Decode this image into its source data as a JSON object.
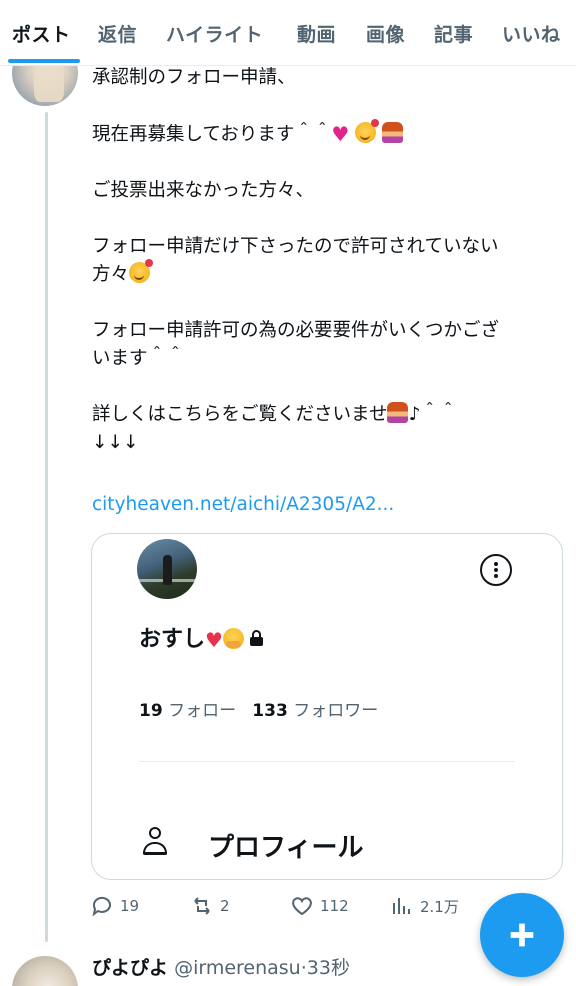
{
  "tabs": [
    {
      "label": "ポスト",
      "active": true
    },
    {
      "label": "返信"
    },
    {
      "label": "ハイライト"
    },
    {
      "label": "動画"
    },
    {
      "label": "画像"
    },
    {
      "label": "記事"
    },
    {
      "label": "いいね"
    }
  ],
  "tweet": {
    "text_lines": [
      "承認制のフォロー申請、",
      "現在再募集しております＾＾",
      "ご投票出来なかった方々、",
      "フォロー申請だけ下さったので許可されていない",
      "方々",
      "フォロー申請許可の為の必要要件がいくつかござ",
      "います＾＾",
      "詳しくはこちらをご覧くださいませ",
      "♪＾＾",
      "↓↓↓"
    ],
    "link": "cityheaven.net/aichi/A2305/A2...",
    "card": {
      "name": "おすし",
      "following_count": "19",
      "following_label": "フォロー",
      "followers_count": "133",
      "followers_label": "フォロワー",
      "profile_label": "プロフィール"
    },
    "actions": {
      "replies": "19",
      "reposts": "2",
      "likes": "112",
      "views": "2.1万"
    }
  },
  "next_tweet": {
    "name": "ぴよぴよ",
    "handle": "@irmerenasu",
    "separator": "·",
    "time": "33秒"
  },
  "icons": {
    "more": "more-circle-icon",
    "lock": "lock-icon",
    "profile": "person-icon",
    "reply": "reply-icon",
    "repost": "repost-icon",
    "like": "heart-icon",
    "views": "views-chart-icon",
    "compose": "plus-icon"
  },
  "colors": {
    "accent": "#1d9bf0",
    "text": "#0f1419",
    "muted": "#536471",
    "heart": "#e0248a"
  }
}
